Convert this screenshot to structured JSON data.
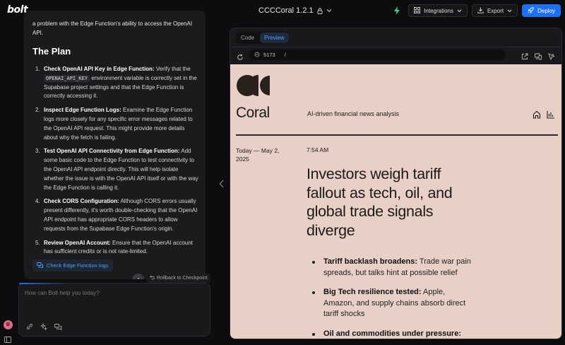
{
  "app": {
    "logo": "bolt",
    "project_title": "CCCCoral 1.2.1"
  },
  "toolbar": {
    "integrations_label": "Integrations",
    "export_label": "Export",
    "deploy_label": "Deploy",
    "accent_color": "#1e6ff2"
  },
  "chat": {
    "intro": "a problem with the Edge Function's ability to access the OpenAI API.",
    "heading": "The Plan",
    "plan": [
      {
        "num": "1.",
        "title": "Check OpenAI API Key in Edge Function:",
        "pre": " Verify that the ",
        "code": "OPENAI_API_KEY",
        "post": " environment variable is correctly set in the Supabase project settings and that the Edge Function is correctly accessing it."
      },
      {
        "num": "2.",
        "title": "Inspect Edge Function Logs:",
        "pre": " Examine the Edge Function logs more closely for any specific error messages related to the OpenAI API request. This might provide more details about why the fetch is failing.",
        "code": "",
        "post": ""
      },
      {
        "num": "3.",
        "title": "Test OpenAI API Connectivity from Edge Function:",
        "pre": " Add some basic code to the Edge Function to test connectivity to the OpenAI API endpoint directly. This will help isolate whether the issue is with the OpenAI API itself or with the way the Edge Function is calling it.",
        "code": "",
        "post": ""
      },
      {
        "num": "4.",
        "title": "Check CORS Configuration:",
        "pre": " Although CORS errors usually present differently, it's worth double-checking that the OpenAI API endpoint has appropriate CORS headers to allow requests from the Supabase Edge Function's origin.",
        "code": "",
        "post": ""
      },
      {
        "num": "5.",
        "title": "Review OpenAI Account:",
        "pre": " Ensure that the OpenAI account has sufficient credits or is not rate-limited.",
        "code": "",
        "post": ""
      }
    ],
    "action_chip": "Check Edge Function logs",
    "rollback_label": "Rollback to Checkpoint",
    "prompt_placeholder": "How can Bolt help you today?"
  },
  "user": {
    "avatar_initial": "B"
  },
  "preview": {
    "tabs": [
      {
        "label": "Code",
        "active": false
      },
      {
        "label": "Preview",
        "active": true
      }
    ],
    "url_port": "5173",
    "url_path": "/"
  },
  "site": {
    "name": "Coral",
    "tagline": "AI-driven financial news analysis",
    "date": "Today — May 2, 2025",
    "time": "7:54 AM",
    "headline": "Investors weigh tariff fallout as tech, oil, and global trade signals diverge",
    "bullets": [
      {
        "title": "Tariff backlash broadens:",
        "text": " Trade war pain spreads, but talks hint at possible relief"
      },
      {
        "title": "Big Tech resilience tested:",
        "text": " Apple, Amazon, and supply chains absorb direct tariff shocks"
      },
      {
        "title": "Oil and commodities under pressure:",
        "text": ""
      }
    ],
    "background_color": "#e9d0c6"
  }
}
